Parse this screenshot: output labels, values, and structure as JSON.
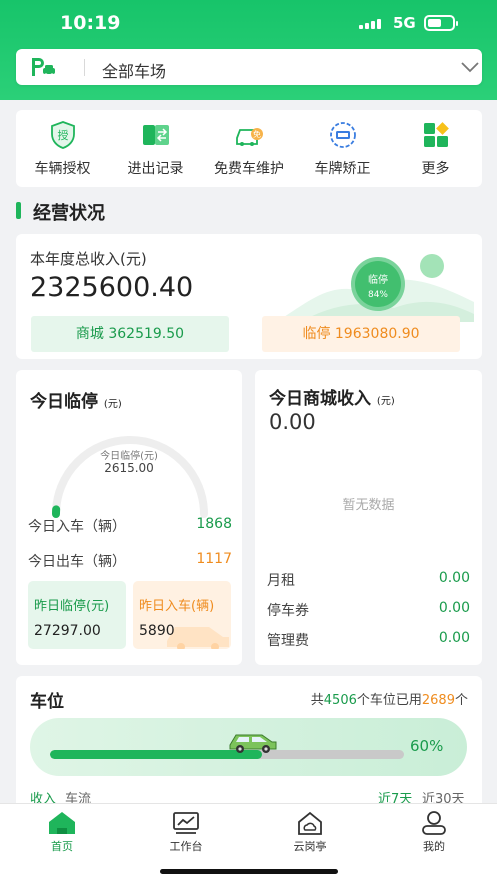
{
  "status_bar": {
    "time": "10:19",
    "network": "5G"
  },
  "lot_selector": {
    "value": "全部车场"
  },
  "quick_actions": [
    {
      "label": "车辆授权",
      "icon": "shield-authorize-icon",
      "icon_glyph": "授"
    },
    {
      "label": "进出记录",
      "icon": "entry-exit-record-icon"
    },
    {
      "label": "免费车维护",
      "icon": "free-car-icon",
      "icon_glyph": "免"
    },
    {
      "label": "车牌矫正",
      "icon": "plate-correct-icon"
    },
    {
      "label": "更多",
      "icon": "more-grid-icon"
    }
  ],
  "section_title": "经营状况",
  "revenue": {
    "label": "本年度总收入(元)",
    "total": "2325600.40",
    "badge_label": "临停",
    "badge_pct": "84%",
    "mall": "商城 362519.50",
    "temp": "临停 1963080.90"
  },
  "today_parking": {
    "title": "今日临停",
    "unit": "(元)",
    "gauge_label": "今日临停(元)",
    "gauge_value": "2615.00",
    "gauge_fraction": 0.02,
    "in_label": "今日入车（辆）",
    "in_value": "1868",
    "out_label": "今日出车（辆）",
    "out_value": "1117",
    "yesterday_park_label": "昨日临停(元)",
    "yesterday_park_value": "27297.00",
    "yesterday_in_label": "昨日入车(辆)",
    "yesterday_in_value": "5890"
  },
  "today_mall": {
    "title": "今日商城收入",
    "unit": "(元)",
    "value": "0.00",
    "empty": "暂无数据",
    "rows": [
      {
        "label": "月租",
        "value": "0.00"
      },
      {
        "label": "停车券",
        "value": "0.00"
      },
      {
        "label": "管理费",
        "value": "0.00"
      }
    ]
  },
  "spaces": {
    "title": "车位",
    "summary_prefix": "共",
    "total": "4506",
    "summary_mid": "个车位已用",
    "used": "2689",
    "summary_suffix": "个",
    "percent": "60%",
    "fraction": 0.6,
    "tab_income": "收入",
    "tab_flow": "车流",
    "range_7": "近7天",
    "range_30": "近30天"
  },
  "tabbar": [
    {
      "label": "首页",
      "icon": "home-icon"
    },
    {
      "label": "工作台",
      "icon": "workbench-icon"
    },
    {
      "label": "云岗亭",
      "icon": "cloud-booth-icon"
    },
    {
      "label": "我的",
      "icon": "profile-icon"
    }
  ],
  "colors": {
    "brand": "#1fb55b",
    "accent_orange": "#ef8c1f",
    "header": "#17c46a"
  }
}
